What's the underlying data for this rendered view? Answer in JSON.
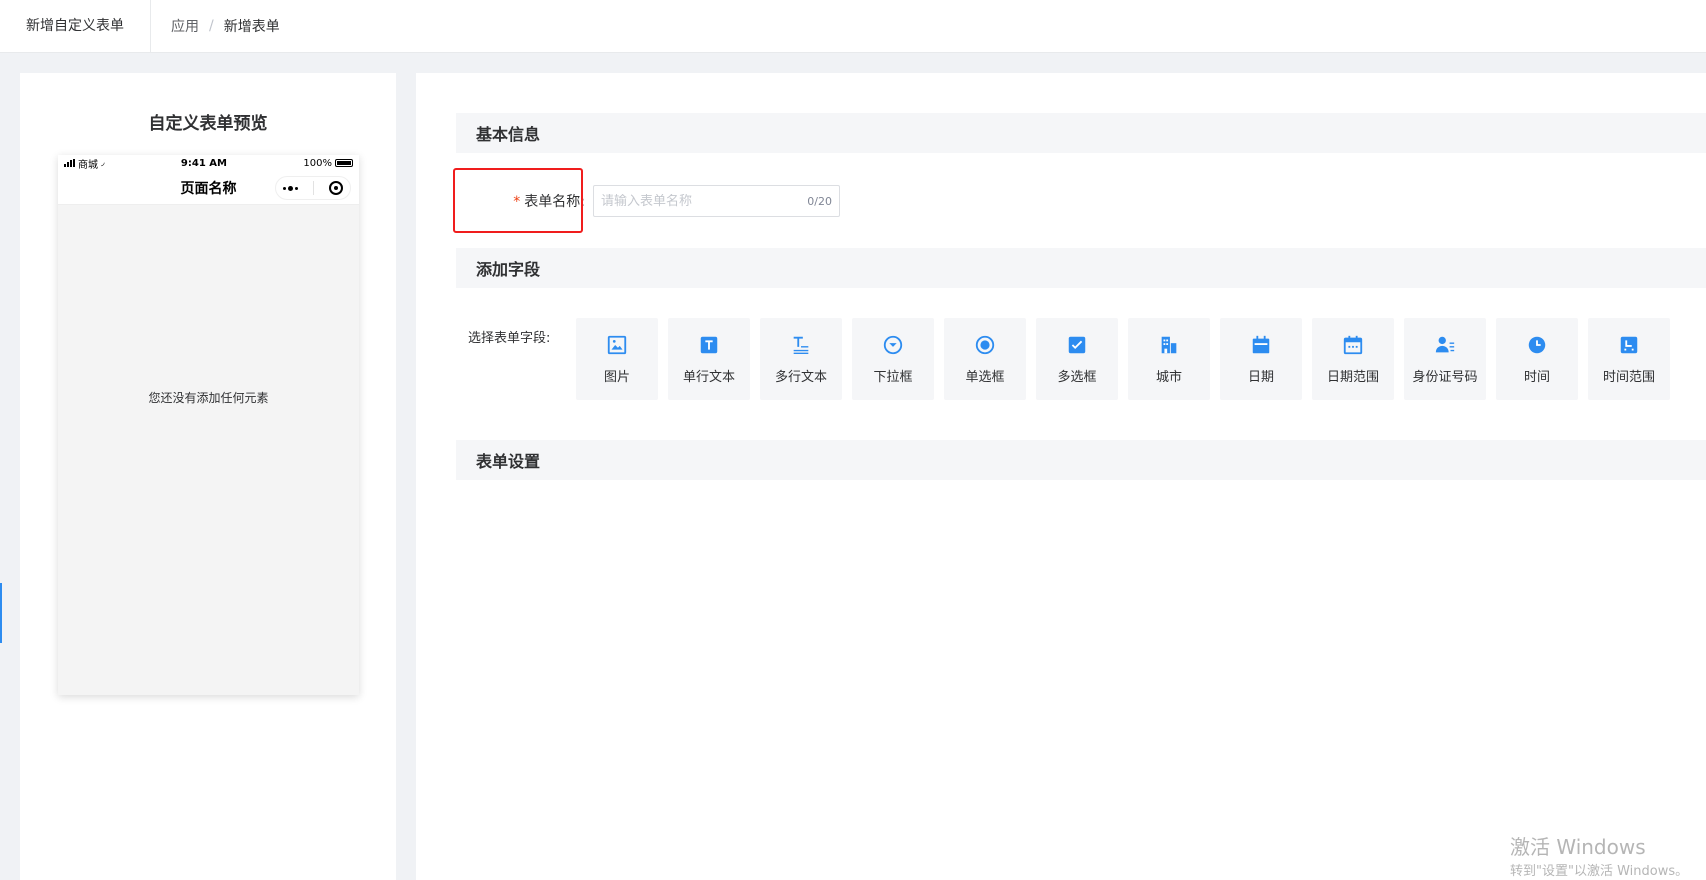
{
  "header": {
    "page_name": "新增自定义表单",
    "breadcrumb": [
      "应用",
      "新增表单"
    ]
  },
  "preview": {
    "title": "自定义表单预览",
    "status_carrier": "商城",
    "status_time": "9:41 AM",
    "status_battery": "100%",
    "nav_title": "页面名称",
    "empty_text": "您还没有添加任何元素"
  },
  "basic_info": {
    "title": "基本信息",
    "form_name_label": "表单名称:",
    "form_name_placeholder": "请输入表单名称",
    "form_name_value": "",
    "form_name_counter": "0/20"
  },
  "add_fields": {
    "title": "添加字段",
    "select_label": "选择表单字段:",
    "items": [
      {
        "label": "图片",
        "icon": "image-icon"
      },
      {
        "label": "单行文本",
        "icon": "text-icon"
      },
      {
        "label": "多行文本",
        "icon": "multiline-text-icon"
      },
      {
        "label": "下拉框",
        "icon": "dropdown-icon"
      },
      {
        "label": "单选框",
        "icon": "radio-icon"
      },
      {
        "label": "多选框",
        "icon": "checkbox-icon"
      },
      {
        "label": "城市",
        "icon": "city-icon"
      },
      {
        "label": "日期",
        "icon": "date-icon"
      },
      {
        "label": "日期范围",
        "icon": "date-range-icon"
      },
      {
        "label": "身份证号码",
        "icon": "id-card-icon"
      },
      {
        "label": "时间",
        "icon": "clock-icon"
      },
      {
        "label": "时间范围",
        "icon": "time-range-icon"
      }
    ]
  },
  "form_settings": {
    "title": "表单设置"
  },
  "watermark": {
    "line1": "激活 Windows",
    "line2": "转到\"设置\"以激活 Windows。"
  },
  "colors": {
    "accent": "#2d8cf0",
    "icon_blue": "#2d8cf0",
    "required": "#ed4014",
    "highlight": "#f01d1d"
  }
}
